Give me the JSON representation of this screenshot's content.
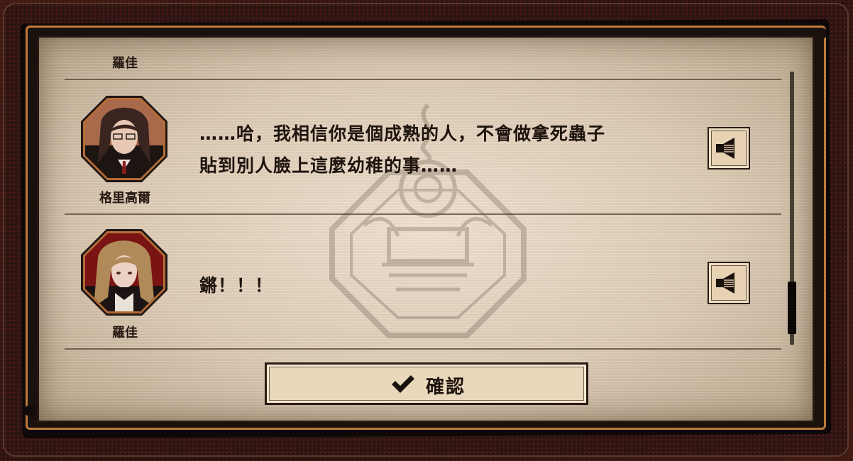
{
  "log": {
    "entries": [
      {
        "speaker": "羅佳",
        "message": ""
      },
      {
        "speaker": "格里高爾",
        "message_line1": "……哈，我相信你是個成熟的人，不會做拿死蟲子",
        "message_line2": "貼到別人臉上這麼幼稚的事……"
      },
      {
        "speaker": "羅佳",
        "message": "鏘！！！"
      }
    ]
  },
  "confirm_label": "確認",
  "icons": {
    "voice": "speaker-icon",
    "confirm": "checkmark-icon",
    "watermark": "emblem-icon"
  },
  "colors": {
    "paper": "#e6d6bf",
    "border_accent": "#c07a3c",
    "text": "#1e140e"
  }
}
